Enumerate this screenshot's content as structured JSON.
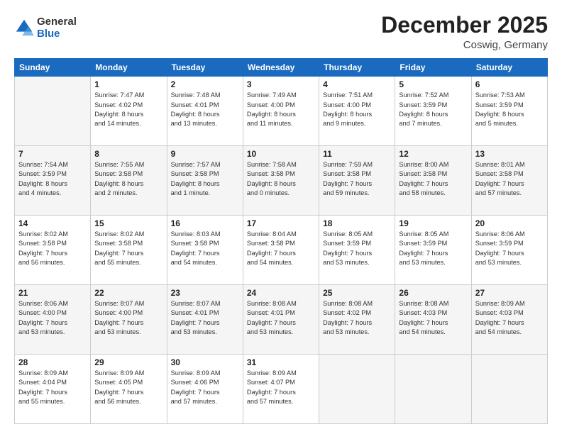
{
  "header": {
    "logo": {
      "general": "General",
      "blue": "Blue"
    },
    "title": "December 2025",
    "location": "Coswig, Germany"
  },
  "calendar": {
    "days_of_week": [
      "Sunday",
      "Monday",
      "Tuesday",
      "Wednesday",
      "Thursday",
      "Friday",
      "Saturday"
    ],
    "weeks": [
      [
        {
          "day": "",
          "info": ""
        },
        {
          "day": "1",
          "info": "Sunrise: 7:47 AM\nSunset: 4:02 PM\nDaylight: 8 hours\nand 14 minutes."
        },
        {
          "day": "2",
          "info": "Sunrise: 7:48 AM\nSunset: 4:01 PM\nDaylight: 8 hours\nand 13 minutes."
        },
        {
          "day": "3",
          "info": "Sunrise: 7:49 AM\nSunset: 4:00 PM\nDaylight: 8 hours\nand 11 minutes."
        },
        {
          "day": "4",
          "info": "Sunrise: 7:51 AM\nSunset: 4:00 PM\nDaylight: 8 hours\nand 9 minutes."
        },
        {
          "day": "5",
          "info": "Sunrise: 7:52 AM\nSunset: 3:59 PM\nDaylight: 8 hours\nand 7 minutes."
        },
        {
          "day": "6",
          "info": "Sunrise: 7:53 AM\nSunset: 3:59 PM\nDaylight: 8 hours\nand 5 minutes."
        }
      ],
      [
        {
          "day": "7",
          "info": "Sunrise: 7:54 AM\nSunset: 3:59 PM\nDaylight: 8 hours\nand 4 minutes."
        },
        {
          "day": "8",
          "info": "Sunrise: 7:55 AM\nSunset: 3:58 PM\nDaylight: 8 hours\nand 2 minutes."
        },
        {
          "day": "9",
          "info": "Sunrise: 7:57 AM\nSunset: 3:58 PM\nDaylight: 8 hours\nand 1 minute."
        },
        {
          "day": "10",
          "info": "Sunrise: 7:58 AM\nSunset: 3:58 PM\nDaylight: 8 hours\nand 0 minutes."
        },
        {
          "day": "11",
          "info": "Sunrise: 7:59 AM\nSunset: 3:58 PM\nDaylight: 7 hours\nand 59 minutes."
        },
        {
          "day": "12",
          "info": "Sunrise: 8:00 AM\nSunset: 3:58 PM\nDaylight: 7 hours\nand 58 minutes."
        },
        {
          "day": "13",
          "info": "Sunrise: 8:01 AM\nSunset: 3:58 PM\nDaylight: 7 hours\nand 57 minutes."
        }
      ],
      [
        {
          "day": "14",
          "info": "Sunrise: 8:02 AM\nSunset: 3:58 PM\nDaylight: 7 hours\nand 56 minutes."
        },
        {
          "day": "15",
          "info": "Sunrise: 8:02 AM\nSunset: 3:58 PM\nDaylight: 7 hours\nand 55 minutes."
        },
        {
          "day": "16",
          "info": "Sunrise: 8:03 AM\nSunset: 3:58 PM\nDaylight: 7 hours\nand 54 minutes."
        },
        {
          "day": "17",
          "info": "Sunrise: 8:04 AM\nSunset: 3:58 PM\nDaylight: 7 hours\nand 54 minutes."
        },
        {
          "day": "18",
          "info": "Sunrise: 8:05 AM\nSunset: 3:59 PM\nDaylight: 7 hours\nand 53 minutes."
        },
        {
          "day": "19",
          "info": "Sunrise: 8:05 AM\nSunset: 3:59 PM\nDaylight: 7 hours\nand 53 minutes."
        },
        {
          "day": "20",
          "info": "Sunrise: 8:06 AM\nSunset: 3:59 PM\nDaylight: 7 hours\nand 53 minutes."
        }
      ],
      [
        {
          "day": "21",
          "info": "Sunrise: 8:06 AM\nSunset: 4:00 PM\nDaylight: 7 hours\nand 53 minutes."
        },
        {
          "day": "22",
          "info": "Sunrise: 8:07 AM\nSunset: 4:00 PM\nDaylight: 7 hours\nand 53 minutes."
        },
        {
          "day": "23",
          "info": "Sunrise: 8:07 AM\nSunset: 4:01 PM\nDaylight: 7 hours\nand 53 minutes."
        },
        {
          "day": "24",
          "info": "Sunrise: 8:08 AM\nSunset: 4:01 PM\nDaylight: 7 hours\nand 53 minutes."
        },
        {
          "day": "25",
          "info": "Sunrise: 8:08 AM\nSunset: 4:02 PM\nDaylight: 7 hours\nand 53 minutes."
        },
        {
          "day": "26",
          "info": "Sunrise: 8:08 AM\nSunset: 4:03 PM\nDaylight: 7 hours\nand 54 minutes."
        },
        {
          "day": "27",
          "info": "Sunrise: 8:09 AM\nSunset: 4:03 PM\nDaylight: 7 hours\nand 54 minutes."
        }
      ],
      [
        {
          "day": "28",
          "info": "Sunrise: 8:09 AM\nSunset: 4:04 PM\nDaylight: 7 hours\nand 55 minutes."
        },
        {
          "day": "29",
          "info": "Sunrise: 8:09 AM\nSunset: 4:05 PM\nDaylight: 7 hours\nand 56 minutes."
        },
        {
          "day": "30",
          "info": "Sunrise: 8:09 AM\nSunset: 4:06 PM\nDaylight: 7 hours\nand 57 minutes."
        },
        {
          "day": "31",
          "info": "Sunrise: 8:09 AM\nSunset: 4:07 PM\nDaylight: 7 hours\nand 57 minutes."
        },
        {
          "day": "",
          "info": ""
        },
        {
          "day": "",
          "info": ""
        },
        {
          "day": "",
          "info": ""
        }
      ]
    ]
  }
}
